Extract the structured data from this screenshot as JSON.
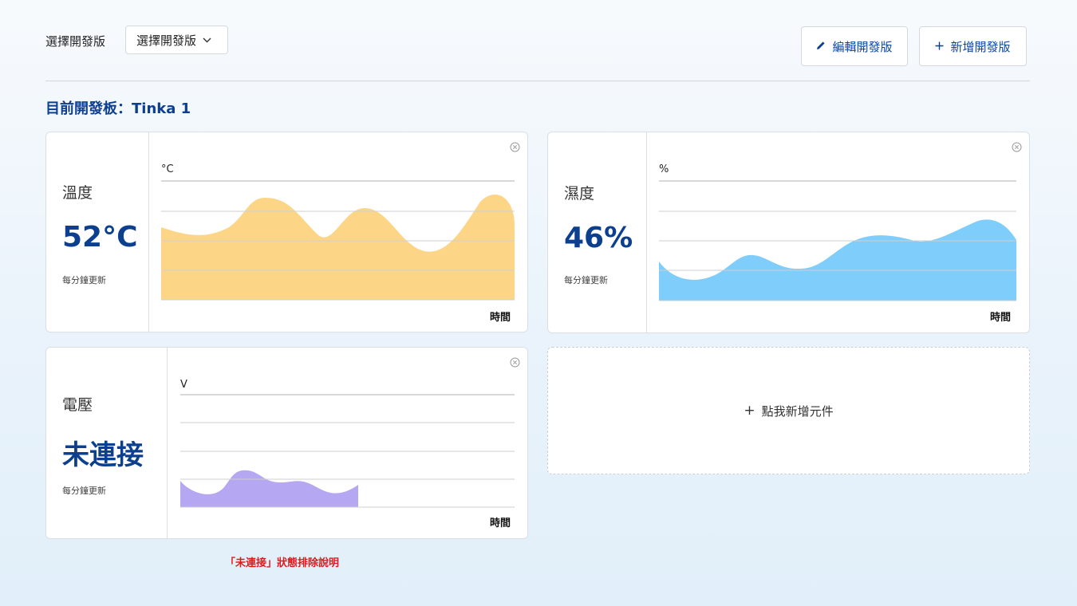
{
  "header": {
    "select_label": "選擇開發版",
    "select_value": "選擇開發版",
    "edit_button": "編輯開發版",
    "add_button": "新增開發版"
  },
  "current_board": {
    "prefix": "目前開發板：",
    "name": "Tinka 1"
  },
  "widgets": [
    {
      "name": "溫度",
      "value": "52°C",
      "update": "每分鐘更新",
      "unit": "°C",
      "xlabel": "時間",
      "color": "#fdd587"
    },
    {
      "name": "濕度",
      "value": "46%",
      "update": "每分鐘更新",
      "unit": "%",
      "xlabel": "時間",
      "color": "#7fcdfb"
    },
    {
      "name": "電壓",
      "value": "未連接",
      "update": "每分鐘更新",
      "unit": "V",
      "xlabel": "時間",
      "color": "#b6a7f2"
    }
  ],
  "add_widget": "點我新增元件",
  "troubleshoot_link": "「未連接」狀態排除說明",
  "icons": {
    "edit": "pencil-icon",
    "add": "plus-icon",
    "dropdown": "chevron-down-icon",
    "close": "close-circle-icon"
  }
}
